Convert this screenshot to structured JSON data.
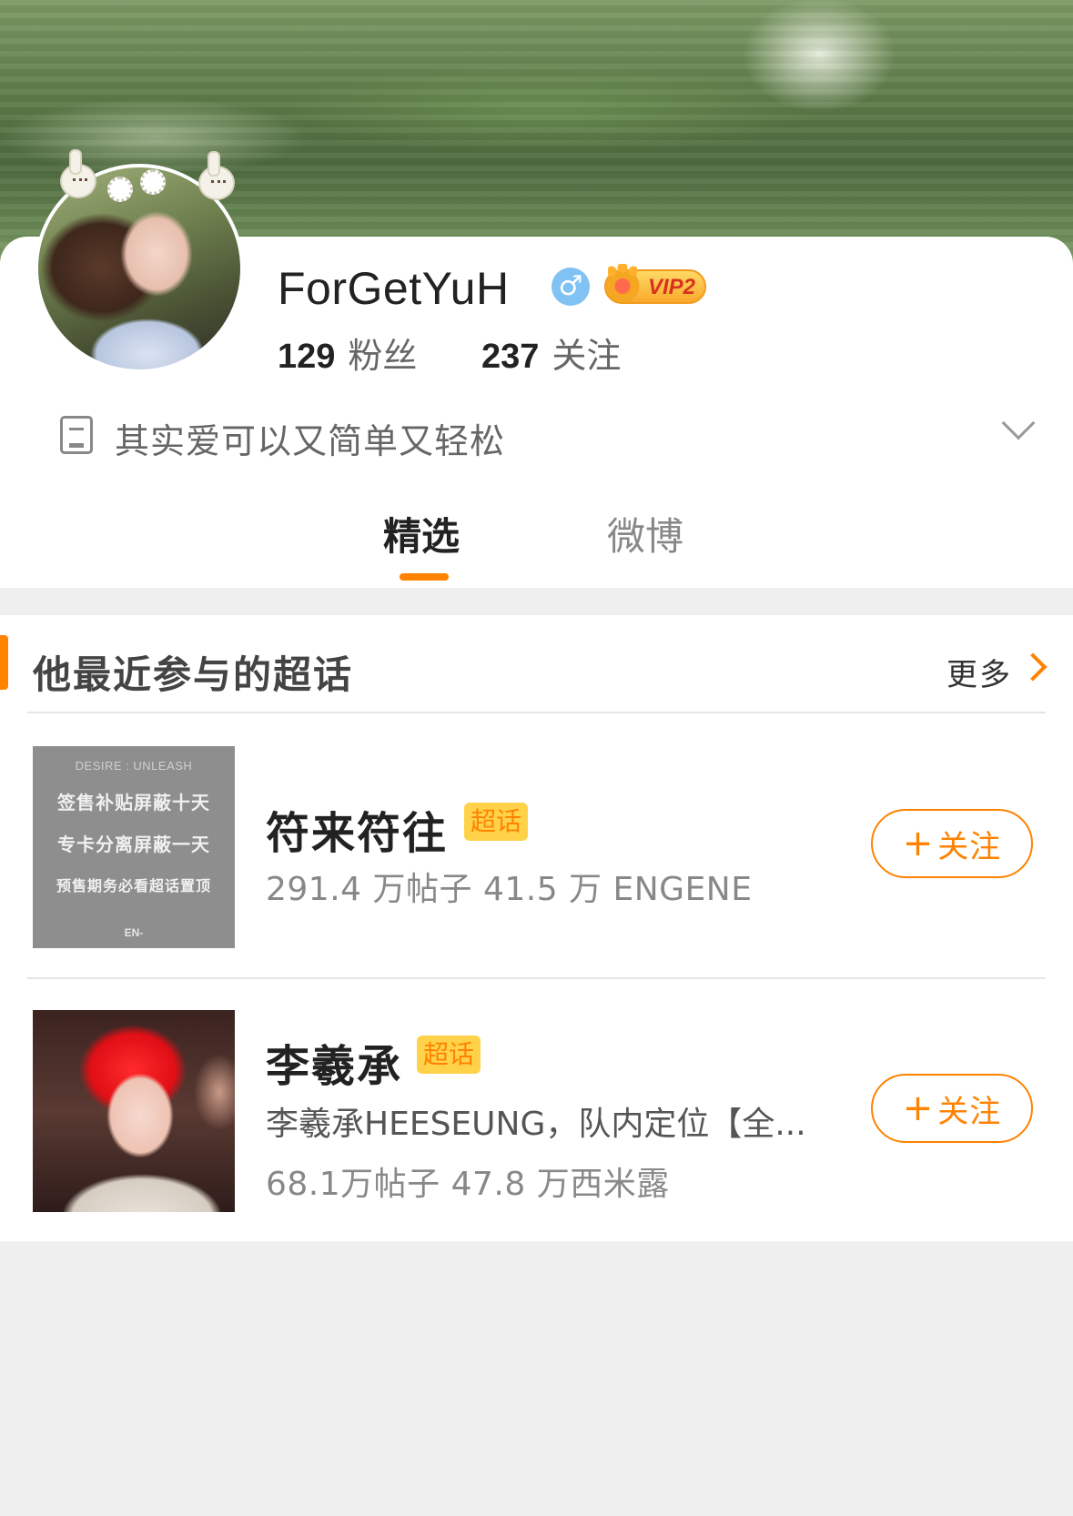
{
  "profile": {
    "name": "ForGetYuH",
    "gender_icon": "male-icon",
    "vip_label": "VIP2",
    "fans_count": "129",
    "fans_label": "粉丝",
    "following_count": "237",
    "following_label": "关注",
    "bio": "其实爱可以又简单又轻松"
  },
  "tabs": [
    {
      "label": "精选",
      "selected": true
    },
    {
      "label": "微博",
      "selected": false
    }
  ],
  "topics_section": {
    "title": "他最近参与的超话",
    "more_label": "更多",
    "super_tag": "超话",
    "follow_label": "关注",
    "items": [
      {
        "name": "符来符往",
        "stats": "291.4 万帖子 41.5 万 ENGENE",
        "thumb_text": {
          "head": "DESIRE : UNLEASH",
          "lines": [
            "签售补贴屏蔽十天",
            "专卡分离屏蔽一天",
            "预售期务必看超话置顶"
          ],
          "logo": "EN-"
        }
      },
      {
        "name": "李羲承",
        "desc": "李羲承HEESEUNG，队内定位【全...",
        "stats": "68.1万帖子 47.8 万西米露"
      }
    ]
  },
  "colors": {
    "accent": "#ff8200",
    "super_tag_bg": "#ffd24a",
    "gender_blue": "#7fc2f3"
  }
}
